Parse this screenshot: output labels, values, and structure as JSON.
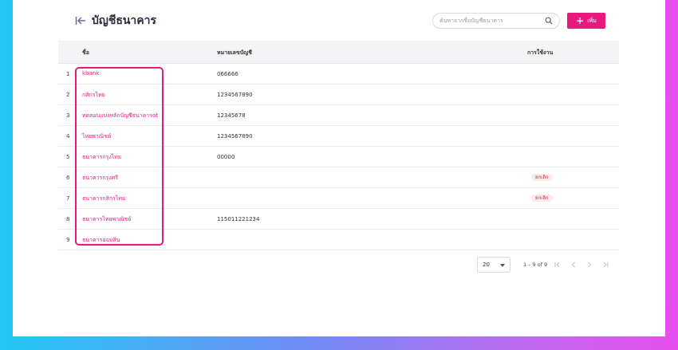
{
  "header": {
    "title": "บัญชีธนาคาร",
    "search_placeholder": "ค้นหาจากชื่อบัญชีธนาคาร",
    "add_label": "เพิ่ม"
  },
  "table": {
    "columns": {
      "name": "ชื่อ",
      "account": "หมายเลขบัญชี",
      "usage": "การใช้งาน"
    },
    "rows": [
      {
        "index": "1",
        "name": "kbank",
        "account": "066666",
        "status": ""
      },
      {
        "index": "2",
        "name": "กสิกรไทย",
        "account": "1234567890",
        "status": ""
      },
      {
        "index": "3",
        "name": "ทดสอบแบ่งหลักบัญชีธนาคารot",
        "account": "12345678",
        "status": ""
      },
      {
        "index": "4",
        "name": "ไทยพาณิชย์",
        "account": "1234567890",
        "status": ""
      },
      {
        "index": "5",
        "name": "ธนาคารกรุงไทย",
        "account": "00000",
        "status": ""
      },
      {
        "index": "6",
        "name": "ธนาคารกรุงศรี",
        "account": "",
        "status": "ยกเลิก"
      },
      {
        "index": "7",
        "name": "ธนาคารกสิกรไทย",
        "account": "",
        "status": "ยกเลิก"
      },
      {
        "index": "8",
        "name": "ธนาคารไทยพาณิชย์",
        "account": "115011221234",
        "status": ""
      },
      {
        "index": "9",
        "name": "ธนาคารออมสิน",
        "account": "",
        "status": ""
      }
    ]
  },
  "pagination": {
    "rows_per_page": "20",
    "range": "1 – 9 of 9"
  },
  "colors": {
    "accent": "#e8197d",
    "badge_bg": "#fde8ea",
    "badge_text": "#d2233c"
  }
}
